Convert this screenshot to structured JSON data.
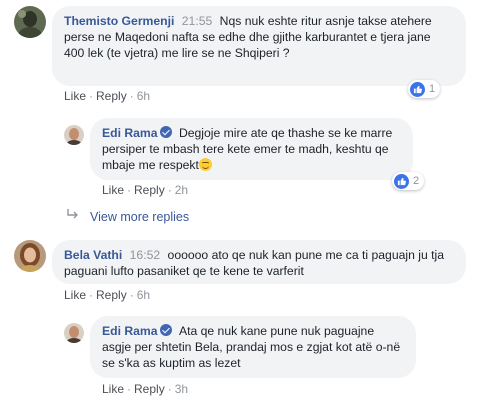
{
  "comments": [
    {
      "author": "Themisto Germenji",
      "time": "21:55",
      "text": "Nqs nuk eshte ritur asnje takse atehere perse ne Maqedoni nafta se edhe dhe gjithe karburantet e tjera jane 400 lek (te vjetra) me lire se ne Shqiperi ?",
      "like_label": "Like",
      "reply_label": "Reply",
      "age": "6h",
      "reaction_count": "1",
      "reply": {
        "author": "Edi Rama",
        "verified": true,
        "text": "Degjoje mire ate qe thashe se ke marre persiper te mbash tere kete emer te madh, keshtu qe mbaje me respekt",
        "emoji": "smiling-face",
        "like_label": "Like",
        "reply_label": "Reply",
        "age": "2h",
        "reaction_count": "2"
      },
      "view_more": "View more replies"
    },
    {
      "author": "Bela Vathi",
      "time": "16:52",
      "text": "oooooo ato qe nuk kan pune me ca ti paguajn ju tja paguani lufto pasaniket qe te kene te varferit",
      "like_label": "Like",
      "reply_label": "Reply",
      "age": "6h",
      "reply": {
        "author": "Edi Rama",
        "verified": true,
        "text": "Ata qe nuk kane pune nuk paguajne asgje per shtetin Bela, prandaj mos e zgjat kot atë o-në se s'ka as kuptim as lezet",
        "like_label": "Like",
        "reply_label": "Reply",
        "age": "3h"
      }
    }
  ],
  "colors": {
    "name": "#385898",
    "bubble": "#f2f3f5",
    "meta": "#90949c",
    "like_blue": "#3b74e6"
  }
}
